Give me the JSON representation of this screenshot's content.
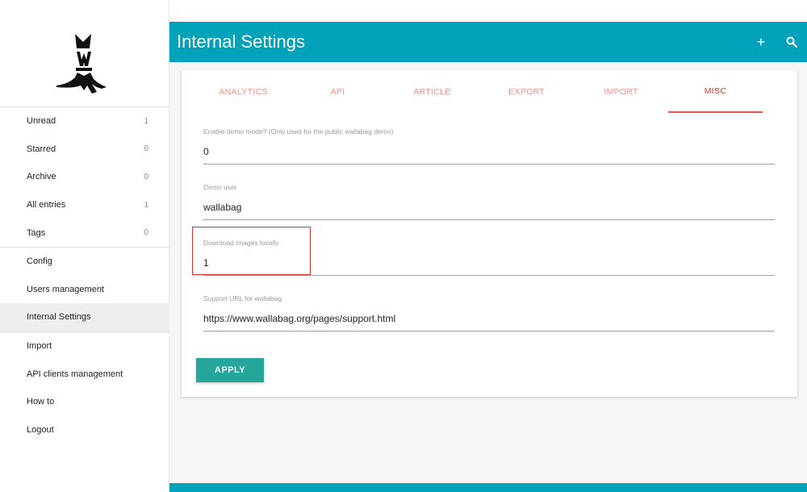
{
  "header": {
    "title": "Internal Settings",
    "add_icon": "+",
    "search_icon": "search-icon"
  },
  "sidebar": {
    "items": [
      {
        "label": "Unread",
        "count": "1"
      },
      {
        "label": "Starred",
        "count": "0"
      },
      {
        "label": "Archive",
        "count": "0"
      },
      {
        "label": "All entries",
        "count": "1"
      },
      {
        "label": "Tags",
        "count": "0"
      },
      {
        "label": "Config"
      },
      {
        "label": "Users management"
      },
      {
        "label": "Internal Settings"
      },
      {
        "label": "Import"
      },
      {
        "label": "API clients management"
      },
      {
        "label": "How to"
      },
      {
        "label": "Logout"
      }
    ]
  },
  "tabs": [
    {
      "label": "ANALYTICS"
    },
    {
      "label": "API"
    },
    {
      "label": "ARTICLE"
    },
    {
      "label": "EXPORT"
    },
    {
      "label": "IMPORT"
    },
    {
      "label": "MISC"
    }
  ],
  "fields": {
    "demo_mode": {
      "label": "Enable demo mode? (Only used for the public wallabag demo)",
      "value": "0"
    },
    "demo_user": {
      "label": "Demo user",
      "value": "wallabag"
    },
    "download_images": {
      "label": "Download images locally",
      "value": "1"
    },
    "support_url": {
      "label": "Support URL for wallabag",
      "value": "https://www.wallabag.org/pages/support.html"
    }
  },
  "apply_label": "APPLY",
  "colors": {
    "header": "#00a2b9",
    "tab_active": "#e7342a",
    "apply": "#26a69a"
  }
}
